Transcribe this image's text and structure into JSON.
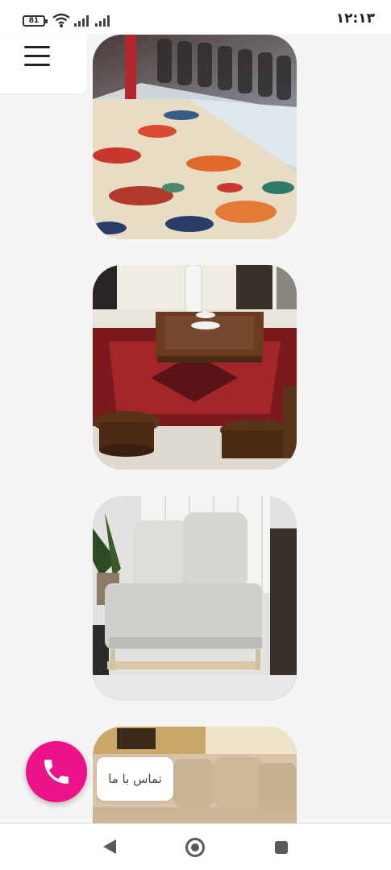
{
  "status_bar": {
    "battery_level": "81",
    "time": "۱۲:۱۳",
    "icons": [
      "battery-icon",
      "wifi-icon",
      "signal-icon",
      "signal-icon"
    ]
  },
  "menu": {
    "icon": "hamburger-menu-icon"
  },
  "gallery": {
    "images": [
      {
        "subject": "carpet-washing-photo"
      },
      {
        "subject": "living-room-carpet-table-photo"
      },
      {
        "subject": "white-sofa-photo"
      },
      {
        "subject": "beige-sofa-photo"
      }
    ]
  },
  "contact": {
    "fab_icon": "phone-icon",
    "fab_color": "#ec1289",
    "label": "تماس با ما"
  },
  "nav": {
    "icons": [
      "back-icon",
      "home-icon",
      "recent-apps-icon"
    ]
  }
}
